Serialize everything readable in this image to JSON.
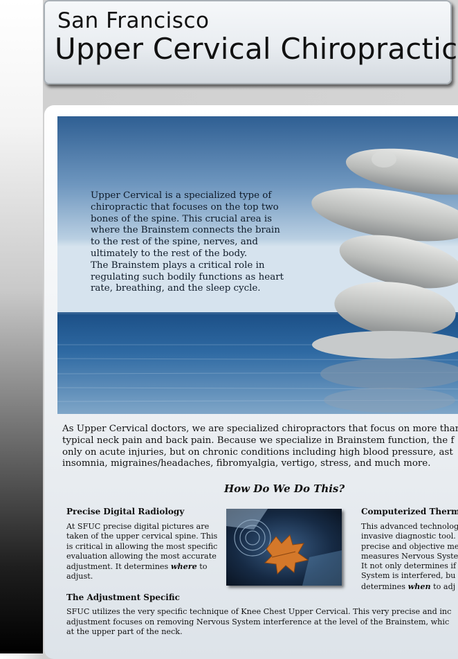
{
  "header": {
    "line1": "San Francisco",
    "line2": "Upper Cervical Chiropractic"
  },
  "hero": {
    "paragraph1": "Upper Cervical is a specialized type of chiropractic that focuses on the top two bones of the spine. This crucial area is where the Brainstem connects the brain to the rest of the spine, nerves, and ultimately to the rest of the body.",
    "paragraph2": "The Brainstem plays a critical role in regulating such bodily functions as heart rate, breathing, and the sleep cycle."
  },
  "intro": {
    "line1": "As Upper Cervical doctors, we are specialized chiropractors that focus on more than",
    "line2": "typical neck pain and back pain. Because we specialize in Brainstem function, the f",
    "line3": "only on acute injuries, but on chronic conditions including high blood pressure, ast",
    "line4": "insomnia, migraines/headaches, fibromyalgia, vertigo, stress, and much more."
  },
  "section_title": "How Do We Do This?",
  "col1": {
    "heading": "Precise Digital Radiology",
    "text_before": "At SFUC precise digital pictures are taken of the upper cervical spine. This is critical in allowing the most specific evaluation allowing the most accurate adjustment. It determines ",
    "emphasis": "where",
    "text_after": " to adjust."
  },
  "col3": {
    "heading": "Computerized Thermo",
    "line1": "This advanced technolog",
    "line2": "invasive diagnostic tool.",
    "line3": "precise and objective me",
    "line4": "measures Nervous Syste",
    "line5": "It not only determines if",
    "line6": "System is interfered, bu",
    "line7_before": "determines ",
    "line7_emphasis": "when",
    "line7_after": " to adj"
  },
  "adjustment": {
    "heading": "The Adjustment Specific",
    "line1": "SFUC utilizes the very specific technique of Knee Chest Upper Cervical. This very precise and inc",
    "line2": "adjustment focuses on removing Nervous System interference at the level of the Brainstem, whic",
    "line3": "at the upper part of the neck."
  }
}
